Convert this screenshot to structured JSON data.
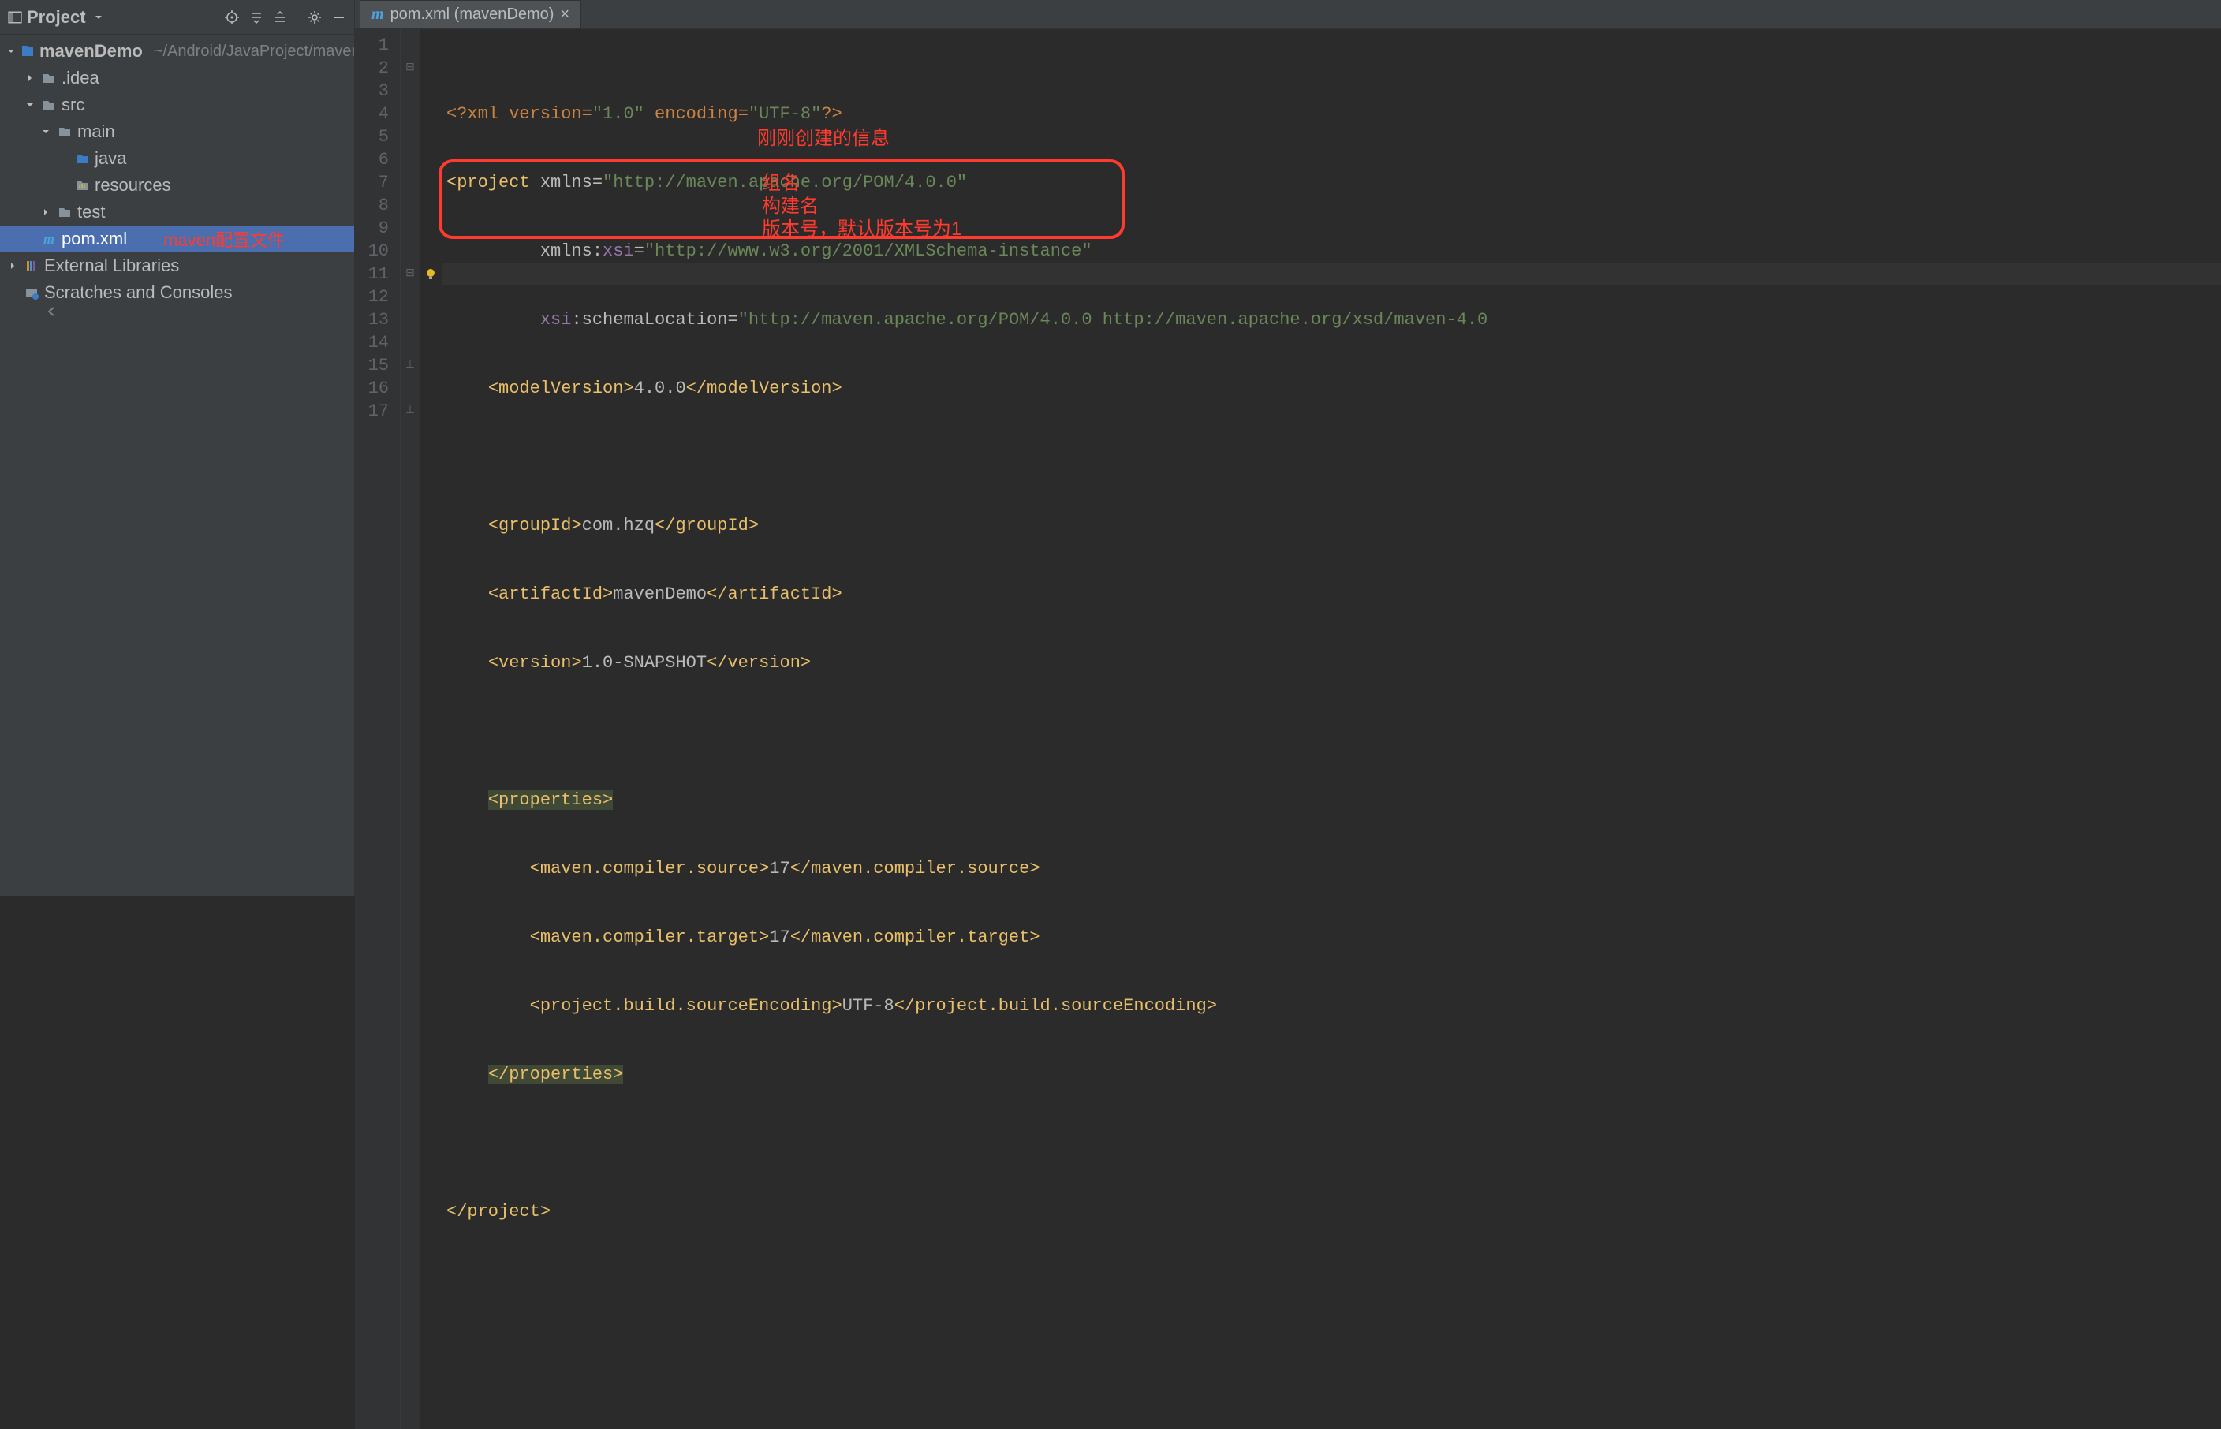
{
  "project_panel": {
    "title": "Project",
    "tree": {
      "root_name": "mavenDemo",
      "root_path": "~/Android/JavaProject/mavenDemo",
      "idea": ".idea",
      "src": "src",
      "main": "main",
      "java": "java",
      "resources": "resources",
      "test": "test",
      "pom": "pom.xml",
      "pom_annot": "maven配置文件",
      "ext_libs": "External Libraries",
      "scratches": "Scratches and Consoles"
    }
  },
  "tab": {
    "label": "pom.xml (mavenDemo)"
  },
  "line_numbers": [
    "1",
    "2",
    "3",
    "4",
    "5",
    "6",
    "7",
    "8",
    "9",
    "10",
    "11",
    "12",
    "13",
    "14",
    "15",
    "16",
    "17"
  ],
  "code": {
    "l1_decl": "<?xml version=\"1.0\" encoding=\"UTF-8\"?>",
    "l1_pre": "<?",
    "l1_xml": "xml version",
    "l1_eq": "=",
    "l1_v": "\"1.0\"",
    "l1_enc": " encoding",
    "l1_ev": "\"UTF-8\"",
    "l1_suf": "?>",
    "l2_tag": "project",
    "l2_attr": "xmlns",
    "l2_val": "\"http://maven.apache.org/POM/4.0.0\"",
    "l3_p": "xmlns:",
    "l3_ns": "xsi",
    "l3_val": "\"http://www.w3.org/2001/XMLSchema-instance\"",
    "l4_p": "xsi",
    "l4_attr": ":schemaLocation",
    "l4_val": "\"http://maven.apache.org/POM/4.0.0 http://maven.apache.org/xsd/maven-4.0",
    "l5_tag": "modelVersion",
    "l5_text": "4.0.0",
    "l7_tag": "groupId",
    "l7_text": "com.hzq",
    "l8_tag": "artifactId",
    "l8_text": "mavenDemo",
    "l9_tag": "version",
    "l9_text": "1.0-SNAPSHOT",
    "l11_tag": "properties",
    "l12_tag": "maven.compiler.source",
    "l12_text": "17",
    "l13_tag": "maven.compiler.target",
    "l13_text": "17",
    "l14_tag": "project.build.sourceEncoding",
    "l14_text": "UTF-8",
    "l17_tag": "project"
  },
  "annotations": {
    "top": "刚刚创建的信息",
    "group": "组名",
    "artifact": "构建名",
    "version": "版本号，默认版本号为1"
  }
}
